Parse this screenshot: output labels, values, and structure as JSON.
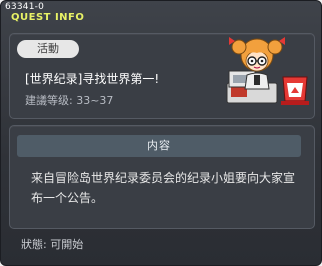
{
  "window": {
    "quest_id": "63341-0",
    "title": "QUEST INFO"
  },
  "quest": {
    "category_badge": "活動",
    "name": "[世界纪录]寻找世界第一!",
    "level_requirement": "建議等级: 33~37"
  },
  "details": {
    "section_title": "内容",
    "description": "来自冒险岛世界纪录委员会的纪录小姐要向大家宣布一个公告。"
  },
  "footer": {
    "status": "狀態: 可開始"
  },
  "colors": {
    "title_accent": "#e8f266",
    "panel_bg": "#3a3e45",
    "header_bg": "#4f5c67"
  }
}
